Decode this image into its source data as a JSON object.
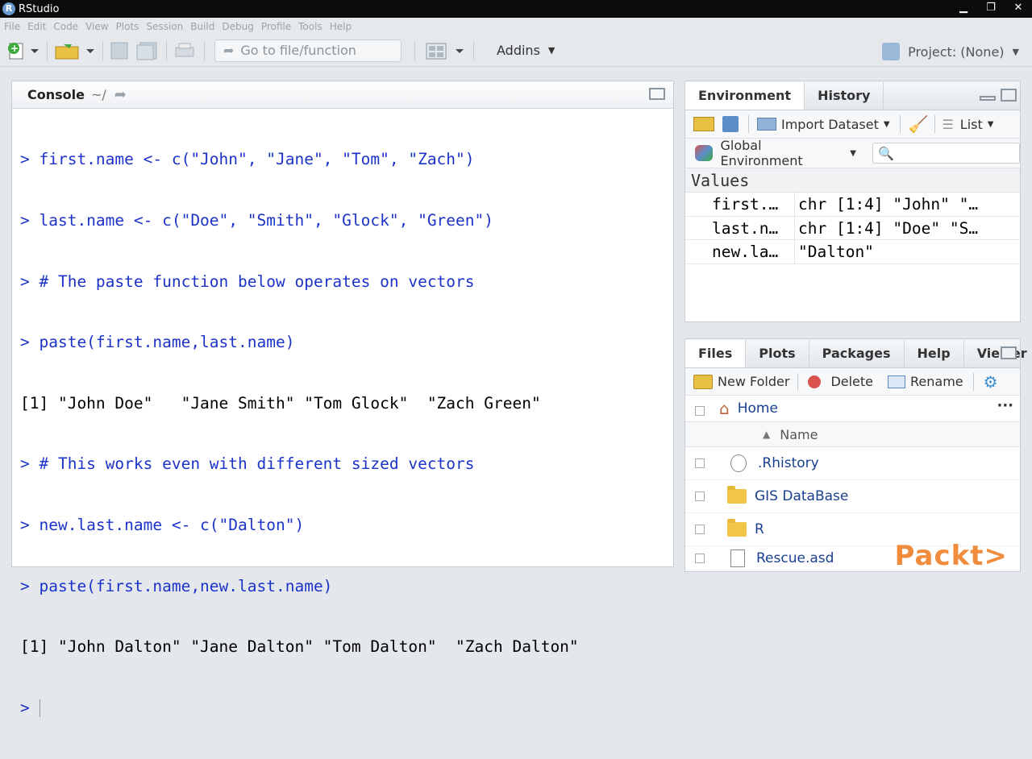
{
  "window": {
    "title": "RStudio"
  },
  "menu": [
    "File",
    "Edit",
    "Code",
    "View",
    "Plots",
    "Session",
    "Build",
    "Debug",
    "Profile",
    "Tools",
    "Help"
  ],
  "toolbar": {
    "goto_placeholder": "Go to file/function",
    "addins_label": "Addins",
    "project_label": "Project: (None)"
  },
  "console": {
    "title": "Console",
    "path": "~/",
    "lines": [
      {
        "type": "cmd",
        "text": "> first.name <- c(\"John\", \"Jane\", \"Tom\", \"Zach\")"
      },
      {
        "type": "cmd",
        "text": "> last.name <- c(\"Doe\", \"Smith\", \"Glock\", \"Green\")"
      },
      {
        "type": "cmd",
        "text": "> # The paste function below operates on vectors"
      },
      {
        "type": "cmd",
        "text": "> paste(first.name,last.name)"
      },
      {
        "type": "out",
        "text": "[1] \"John Doe\"   \"Jane Smith\" \"Tom Glock\"  \"Zach Green\""
      },
      {
        "type": "cmd",
        "text": "> # This works even with different sized vectors"
      },
      {
        "type": "cmd",
        "text": "> new.last.name <- c(\"Dalton\")"
      },
      {
        "type": "cmd",
        "text": "> paste(first.name,new.last.name)"
      },
      {
        "type": "out",
        "text": "[1] \"John Dalton\" \"Jane Dalton\" \"Tom Dalton\"  \"Zach Dalton\""
      }
    ],
    "prompt": ">"
  },
  "environment": {
    "tabs": [
      "Environment",
      "History"
    ],
    "import_label": "Import Dataset",
    "list_label": "List",
    "scope_label": "Global Environment",
    "section": "Values",
    "rows": [
      {
        "name": "first.…",
        "value": "chr [1:4] \"John\" \"…"
      },
      {
        "name": "last.n…",
        "value": "chr [1:4] \"Doe\" \"S…"
      },
      {
        "name": "new.la…",
        "value": "\"Dalton\""
      }
    ]
  },
  "files": {
    "tabs": [
      "Files",
      "Plots",
      "Packages",
      "Help",
      "Viewer"
    ],
    "new_folder": "New Folder",
    "delete": "Delete",
    "rename": "Rename",
    "home": "Home",
    "name_col": "Name",
    "items": [
      ".Rhistory",
      "GIS DataBase",
      "R",
      "Rescue.asd"
    ]
  },
  "watermark": "Packt>"
}
